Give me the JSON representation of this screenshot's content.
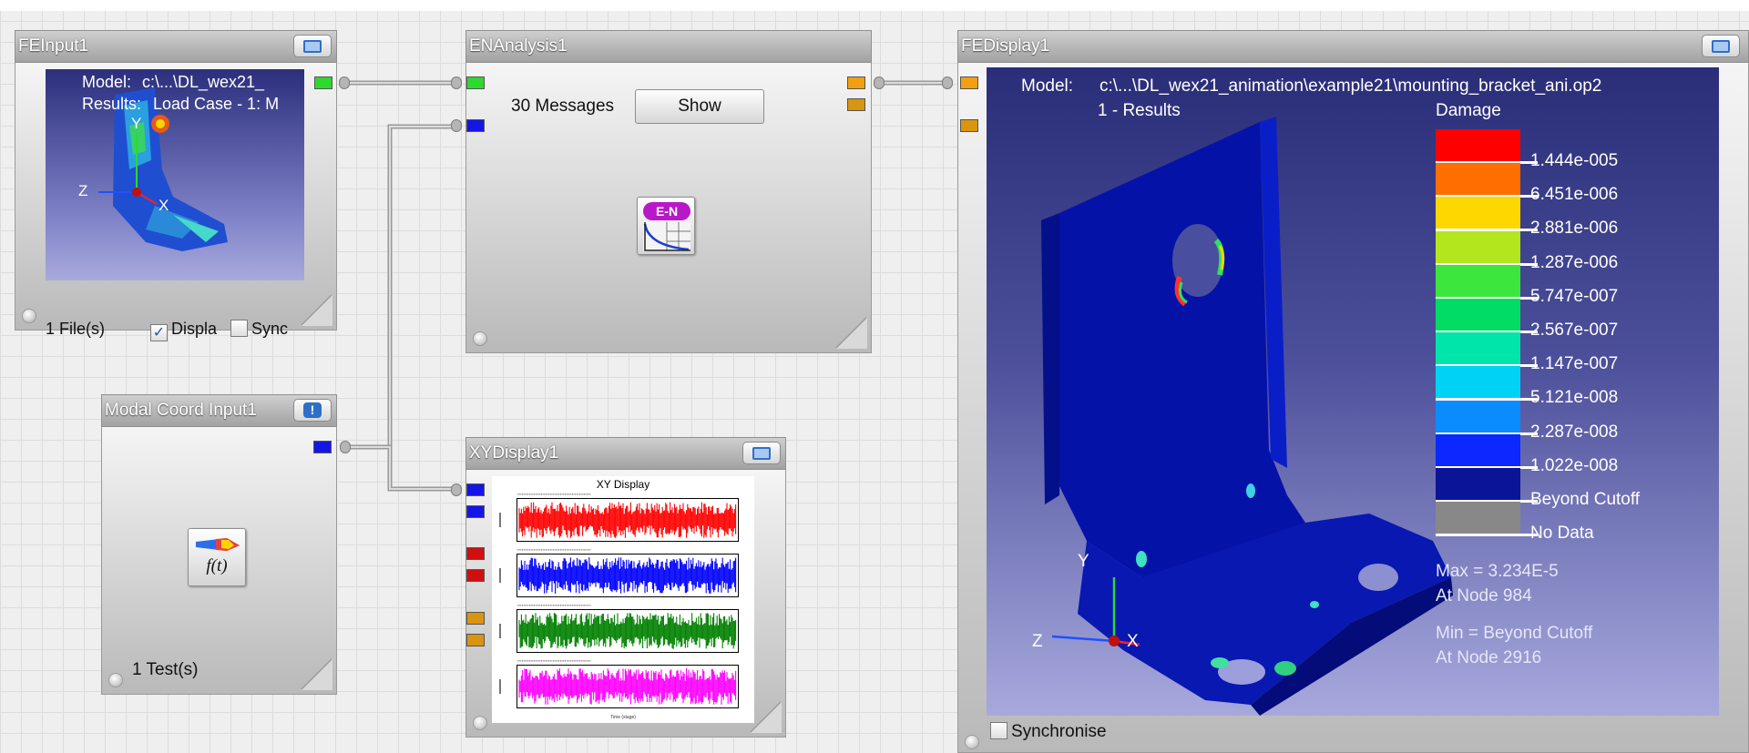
{
  "nodes": {
    "fe_input": {
      "title": "FEInput1",
      "preview": {
        "model_label": "Model:",
        "model_value": "c:\\...\\DL_wex21_",
        "results_label": "Results:",
        "results_value": "Load Case - 1: M",
        "axis_y": "Y",
        "axis_z": "Z",
        "axis_x": "X"
      },
      "files_label": "1 File(s)",
      "display_checkbox": {
        "label": "Displa",
        "checked": true
      },
      "sync_checkbox": {
        "label": "Sync",
        "checked": false
      }
    },
    "en_analysis": {
      "title": "ENAnalysis1",
      "messages_label": "30 Messages",
      "show_button": "Show",
      "icon_text": "E-N"
    },
    "modal_input": {
      "title": "Modal Coord Input1",
      "tests_label": "1 Test(s)",
      "icon_text": "f(t)"
    },
    "xy_display": {
      "title": "XYDisplay1",
      "plot_title": "XY Display",
      "plot_xlabel": "Time (stage)",
      "series_colors": [
        "#ff0000",
        "#0000ff",
        "#008000",
        "#ff00ff"
      ]
    },
    "fe_display": {
      "title": "FEDisplay1",
      "model_label": "Model:",
      "model_value": "c:\\...\\DL_wex21_animation\\example21\\mounting_bracket_ani.op2",
      "results_value": "1 - Results",
      "legend_title": "Damage",
      "legend": [
        {
          "color": "#ff0000",
          "label": "1.444e-005"
        },
        {
          "color": "#ff6e00",
          "label": "6.451e-006"
        },
        {
          "color": "#ffd700",
          "label": "2.881e-006"
        },
        {
          "color": "#b4e61e",
          "label": "1.287e-006"
        },
        {
          "color": "#3ce63c",
          "label": "5.747e-007"
        },
        {
          "color": "#00dc64",
          "label": "2.567e-007"
        },
        {
          "color": "#00e6aa",
          "label": "1.147e-007"
        },
        {
          "color": "#00d2f5",
          "label": "5.121e-008"
        },
        {
          "color": "#0a8cff",
          "label": "2.287e-008"
        },
        {
          "color": "#0a28ff",
          "label": "1.022e-008"
        },
        {
          "color": "#0a1496",
          "label": "Beyond Cutoff"
        },
        {
          "color": "#888888",
          "label": "No Data"
        }
      ],
      "max_label": "Max = 3.234E-5",
      "max_node": "At Node 984",
      "min_label": "Min = Beyond Cutoff",
      "min_node": "At Node 2916",
      "axis_y": "Y",
      "axis_z": "Z",
      "axis_x": "X",
      "synchronise": {
        "label": "Synchronise",
        "checked": false
      }
    }
  },
  "ports": {
    "green": "#2ed82e",
    "blue": "#1515e6",
    "orange": "#f0a010",
    "red": "#d01010"
  }
}
